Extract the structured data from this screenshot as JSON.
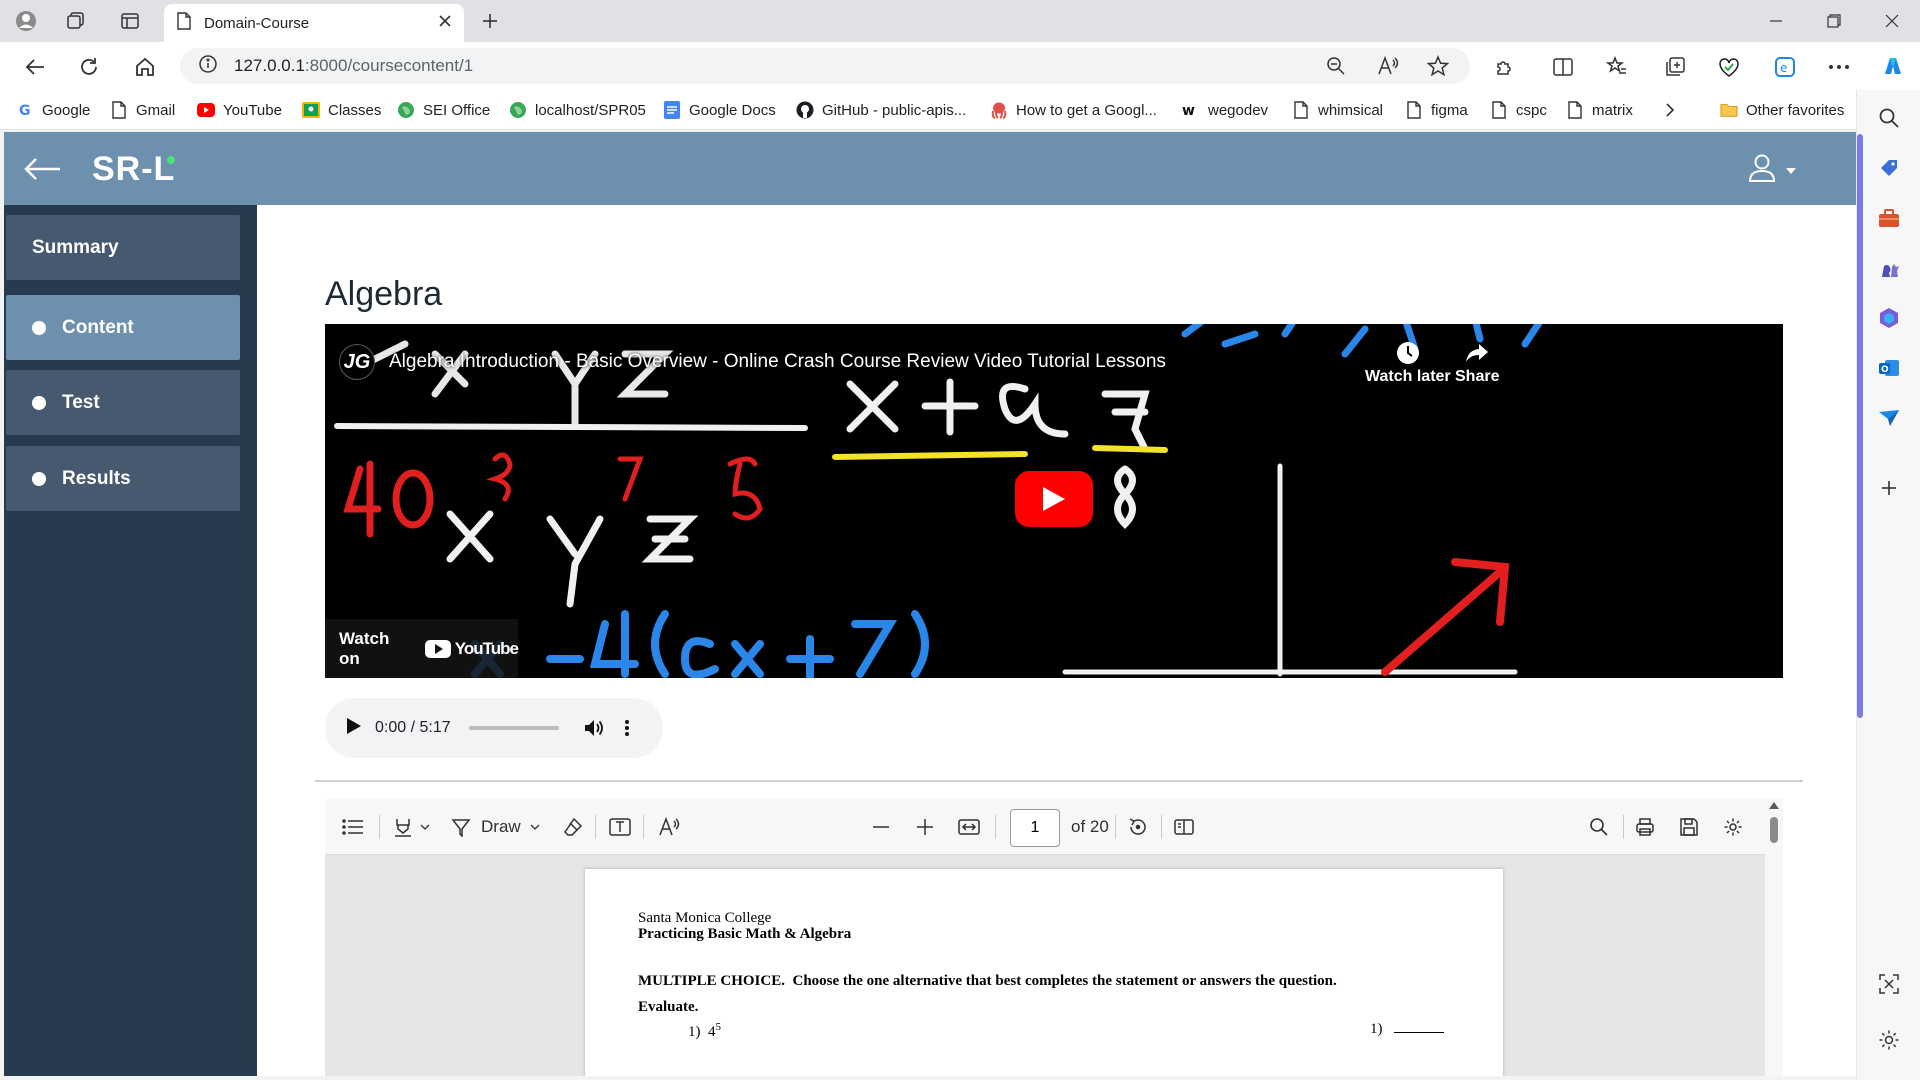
{
  "browser": {
    "tab_title": "Domain-Course",
    "url_host": "127.0.0.1",
    "url_path": ":8000/coursecontent/1",
    "bookmarks": [
      {
        "label": "Google",
        "icon": "google-icon"
      },
      {
        "label": "Gmail",
        "icon": "page-icon"
      },
      {
        "label": "YouTube",
        "icon": "youtube-icon"
      },
      {
        "label": "Classes",
        "icon": "classroom-icon"
      },
      {
        "label": "SEI Office",
        "icon": "globe-icon"
      },
      {
        "label": "localhost/SPR05",
        "icon": "globe-icon"
      },
      {
        "label": "Google Docs",
        "icon": "docs-icon"
      },
      {
        "label": "GitHub - public-apis...",
        "icon": "github-icon"
      },
      {
        "label": "How to get a Googl...",
        "icon": "octopus-icon"
      },
      {
        "label": "wegodev",
        "icon": "w-icon"
      },
      {
        "label": "whimsical",
        "icon": "page-icon"
      },
      {
        "label": "figma",
        "icon": "page-icon"
      },
      {
        "label": "cspc",
        "icon": "page-icon"
      },
      {
        "label": "matrix",
        "icon": "page-icon"
      }
    ],
    "other_favorites": "Other favorites"
  },
  "app": {
    "brand": "SR-L",
    "sidebar": [
      {
        "label": "Summary",
        "has_dot": false,
        "active": false
      },
      {
        "label": "Content",
        "has_dot": true,
        "active": true
      },
      {
        "label": "Test",
        "has_dot": true,
        "active": false
      },
      {
        "label": "Results",
        "has_dot": true,
        "active": false
      }
    ],
    "page_title": "Algebra"
  },
  "video": {
    "channel_initials": "JG",
    "title": "Algebra Introduction - Basic Overview - Online Crash Course Review Video Tutorial Lessons",
    "watch_later": "Watch later",
    "share": "Share",
    "watch_on": "Watch on",
    "youtube": "YouTube"
  },
  "audio": {
    "time": "0:00 / 5:17",
    "progress": 0
  },
  "pdf": {
    "draw_label": "Draw",
    "page_number": "1",
    "page_total": "of 20",
    "lines": {
      "college": "Santa Monica College",
      "course": "Practicing Basic Math & Algebra",
      "mc_bold": "MULTIPLE CHOICE.",
      "mc_text": "Choose the one alternative that best completes the statement or answers the question.",
      "evaluate": "Evaluate.",
      "q1_num": "1)",
      "q1_base": "4",
      "q1_exp": "5",
      "q1_answer_num": "1)"
    }
  },
  "colors": {
    "header": "#6d90ae",
    "sidebar": "#283a4e",
    "sidebar_item": "#46596e",
    "active_item": "#6d90ae",
    "yt_red": "#ff0000"
  }
}
